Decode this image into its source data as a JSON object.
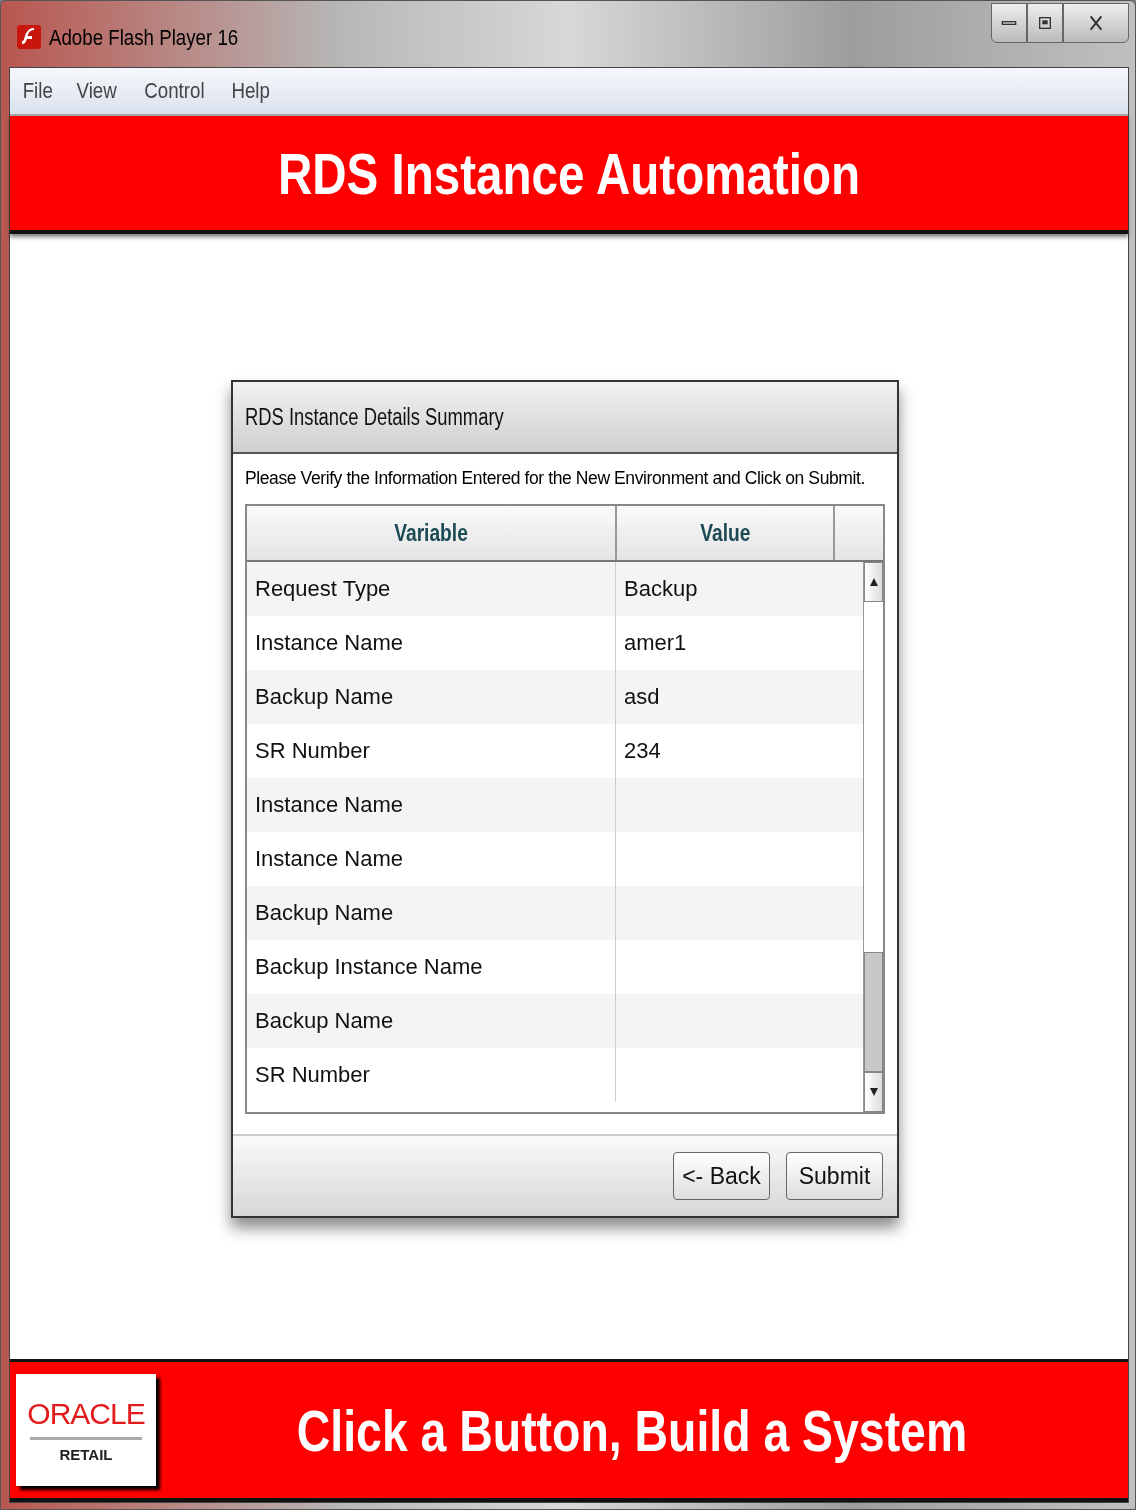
{
  "window": {
    "title": "Adobe Flash Player 16"
  },
  "menu": [
    "File",
    "View",
    "Control",
    "Help"
  ],
  "header": {
    "title": "RDS Instance Automation"
  },
  "dialog": {
    "title": "RDS Instance Details Summary",
    "instruction": "Please Verify the Information Entered for the New Environment and Click on Submit.",
    "table": {
      "columns": [
        "Variable",
        "Value"
      ],
      "rows": [
        {
          "variable": "Request Type",
          "value": "Backup"
        },
        {
          "variable": "Instance Name",
          "value": "amer1"
        },
        {
          "variable": "Backup Name",
          "value": "asd"
        },
        {
          "variable": "SR Number",
          "value": "234"
        },
        {
          "variable": "Instance Name"
        },
        {
          "variable": "Instance Name"
        },
        {
          "variable": "Backup Name"
        },
        {
          "variable": "Backup Instance Name"
        },
        {
          "variable": "Backup Name"
        },
        {
          "variable": "SR Number"
        }
      ]
    },
    "buttons": [
      "<- Back",
      "Submit"
    ]
  },
  "footer": {
    "logo": "ORACLE",
    "logo_sub": "RETAIL",
    "slogan": "Click a Button, Build a System"
  }
}
